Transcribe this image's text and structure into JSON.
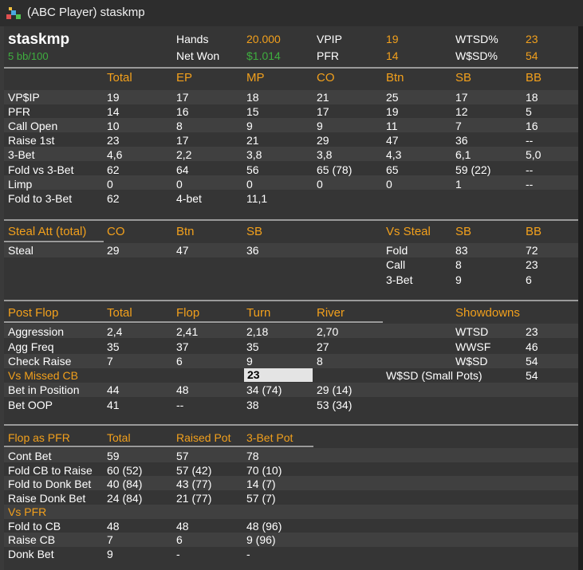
{
  "window": {
    "title": "(ABC Player) staskmp"
  },
  "header": {
    "player": "staskmp",
    "winrate": "5 bb/100",
    "hands_label": "Hands",
    "hands_value": "20.000",
    "netwon_label": "Net Won",
    "netwon_value": "$1.014",
    "vpip_label": "VPIP",
    "vpip_value": "19",
    "pfr_label": "PFR",
    "pfr_value": "14",
    "wtsd_label": "WTSD%",
    "wtsd_value": "23",
    "wsd_label": "W$SD%",
    "wsd_value": "54"
  },
  "preflop": {
    "headers": [
      "Total",
      "EP",
      "MP",
      "CO",
      "Btn",
      "SB",
      "BB"
    ],
    "rows": [
      {
        "label": "VP$IP",
        "values": [
          "19",
          "17",
          "18",
          "21",
          "25",
          "17",
          "18"
        ]
      },
      {
        "label": "PFR",
        "values": [
          "14",
          "16",
          "15",
          "17",
          "19",
          "12",
          "5"
        ]
      },
      {
        "label": "Call Open",
        "values": [
          "10",
          "8",
          "9",
          "9",
          "11",
          "7",
          "16"
        ]
      },
      {
        "label": "Raise 1st",
        "values": [
          "23",
          "17",
          "21",
          "29",
          "47",
          "36",
          "--"
        ]
      },
      {
        "label": "3-Bet",
        "values": [
          "4,6",
          "2,2",
          "3,8",
          "3,8",
          "4,3",
          "6,1",
          "5,0"
        ]
      },
      {
        "label": "Fold vs 3-Bet",
        "values": [
          "62",
          "64",
          "56",
          "65 (78)",
          "65",
          "59 (22)",
          "--"
        ]
      },
      {
        "label": "Limp",
        "values": [
          "0",
          "0",
          "0",
          "0",
          "0",
          "1",
          "--"
        ]
      },
      {
        "label": "Fold to 3-Bet",
        "values": [
          "62",
          "4-bet",
          "11,1",
          "",
          "",
          "",
          ""
        ]
      }
    ]
  },
  "steal": {
    "title": "Steal Att (total)",
    "headers": [
      "CO",
      "Btn",
      "SB"
    ],
    "row": {
      "label": "Steal",
      "values": [
        "29",
        "47",
        "36"
      ]
    },
    "vs_title": "Vs Steal",
    "vs_headers": [
      "SB",
      "BB"
    ],
    "vs_rows": [
      {
        "label": "Fold",
        "values": [
          "83",
          "72"
        ]
      },
      {
        "label": "Call",
        "values": [
          "8",
          "23"
        ]
      },
      {
        "label": "3-Bet",
        "values": [
          "9",
          "6"
        ]
      }
    ]
  },
  "postflop": {
    "title": "Post Flop",
    "headers": [
      "Total",
      "Flop",
      "Turn",
      "River"
    ],
    "rows": [
      {
        "label": "Aggression",
        "values": [
          "2,4",
          "2,41",
          "2,18",
          "2,70"
        ]
      },
      {
        "label": "Agg Freq",
        "values": [
          "35",
          "37",
          "35",
          "27"
        ]
      },
      {
        "label": "Check Raise",
        "values": [
          "7",
          "6",
          "9",
          "8"
        ]
      },
      {
        "label": "Vs Missed CB",
        "values": [
          "",
          "",
          "23",
          ""
        ]
      },
      {
        "label": "Bet in Position",
        "values": [
          "44",
          "48",
          "34 (74)",
          "29 (14)"
        ]
      },
      {
        "label": "Bet OOP",
        "values": [
          "41",
          "--",
          "38",
          "53 (34)"
        ]
      }
    ],
    "showdowns_title": "Showdowns",
    "showdowns": [
      {
        "label": "WTSD",
        "value": "23"
      },
      {
        "label": "WWSF",
        "value": "46"
      },
      {
        "label": "W$SD",
        "value": "54"
      },
      {
        "label": "W$SD (Small Pots)",
        "value": "54"
      }
    ]
  },
  "flop_pfr": {
    "title": "Flop as PFR",
    "headers": [
      "Total",
      "Raised Pot",
      "3-Bet Pot"
    ],
    "rows": [
      {
        "label": "Cont Bet",
        "values": [
          "59",
          "57",
          "78"
        ]
      },
      {
        "label": "Fold CB to Raise",
        "values": [
          "60 (52)",
          "57 (42)",
          "70 (10)"
        ]
      },
      {
        "label": "Fold to Donk Bet",
        "values": [
          "40 (84)",
          "43 (77)",
          "14 (7)"
        ]
      },
      {
        "label": "Raise Donk Bet",
        "values": [
          "24 (84)",
          "21 (77)",
          "57 (7)"
        ]
      }
    ],
    "vs_title": "Vs PFR",
    "vs_rows": [
      {
        "label": "Fold to CB",
        "values": [
          "48",
          "48",
          "48 (96)"
        ]
      },
      {
        "label": "Raise CB",
        "values": [
          "7",
          "6",
          "9 (96)"
        ]
      },
      {
        "label": "Donk Bet",
        "values": [
          "9",
          "-",
          "-"
        ]
      }
    ]
  },
  "colors": {
    "accent": "#f2a01c",
    "positive": "#3fae3f",
    "background": "#353535",
    "stripe": "#404040"
  }
}
